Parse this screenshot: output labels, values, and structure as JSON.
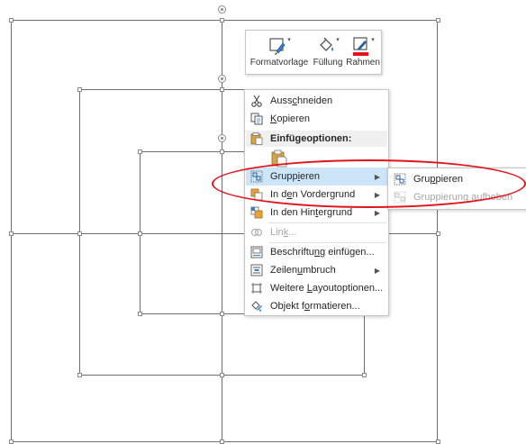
{
  "mini_toolbar": {
    "style_label": "Formatvorlage",
    "fill_label": "Füllung",
    "border_label": "Rahmen",
    "border_color": "#e3141c"
  },
  "context_menu": {
    "cut": {
      "pre": "Auss",
      "key": "c",
      "post": "hneiden"
    },
    "copy": {
      "pre": "",
      "key": "K",
      "post": "opieren"
    },
    "paste_options_header": "Einfügeoptionen:",
    "group": {
      "pre": "Grupp",
      "key": "i",
      "post": "eren"
    },
    "bring_forward": {
      "pre": "In d",
      "key": "e",
      "post": "n Vordergrund"
    },
    "send_backward": {
      "pre": "In den Hin",
      "key": "t",
      "post": "ergrund"
    },
    "link": {
      "pre": "Lin",
      "key": "k",
      "post": "..."
    },
    "insert_caption": {
      "pre": "Beschriftu",
      "key": "n",
      "post": "g einfügen..."
    },
    "wrap_text": {
      "pre": "Zeilen",
      "key": "u",
      "post": "mbruch"
    },
    "more_layout": {
      "pre": "Weitere ",
      "key": "L",
      "post": "ayoutoptionen..."
    },
    "format_object": {
      "pre": "Objekt f",
      "key": "o",
      "post": "rmatieren..."
    }
  },
  "submenu": {
    "group": {
      "pre": "Gru",
      "key": "p",
      "post": "pieren"
    },
    "ungroup": {
      "pre": "",
      "key": "",
      "post": "Gruppierung aufheben"
    }
  },
  "colors": {
    "highlight": "#cde6f7",
    "annotation": "#e3141c"
  }
}
